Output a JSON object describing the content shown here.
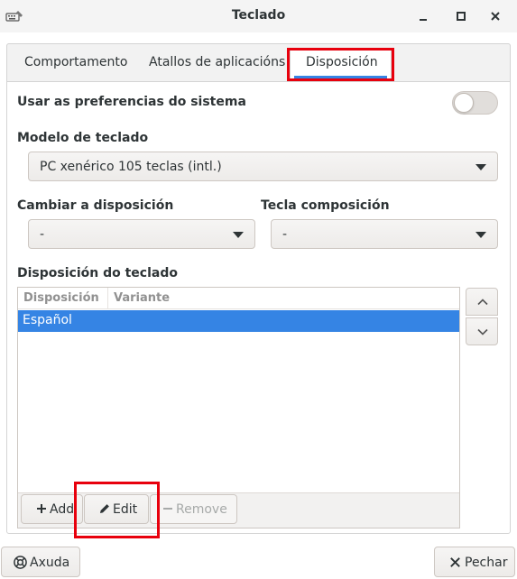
{
  "window": {
    "title": "Teclado",
    "app_icon": "keyboard-settings-icon"
  },
  "tabs": [
    {
      "label": "Comportamento",
      "active": false
    },
    {
      "label": "Atallos de aplicacións",
      "active": false
    },
    {
      "label": "Disposición",
      "active": true
    }
  ],
  "prefs": {
    "label": "Usar as preferencias do sistema",
    "enabled": false
  },
  "model": {
    "label": "Modelo de teclado",
    "value": "PC xenérico 105 teclas (intl.)"
  },
  "switch_layout": {
    "label": "Cambiar a disposición",
    "value": "-"
  },
  "compose_key": {
    "label": "Tecla composición",
    "value": "-"
  },
  "layout_list": {
    "label": "Disposición do teclado",
    "columns": [
      "Disposición",
      "Variante"
    ],
    "rows": [
      {
        "layout": "Español",
        "variant": "",
        "selected": true
      }
    ]
  },
  "list_toolbar": {
    "add_label": "Add",
    "edit_label": "Edit",
    "remove_label": "Remove"
  },
  "footer": {
    "help_label": "Axuda",
    "close_label": "Pechar"
  },
  "colors": {
    "accent": "#3584e4",
    "highlight": "#e8000d"
  }
}
